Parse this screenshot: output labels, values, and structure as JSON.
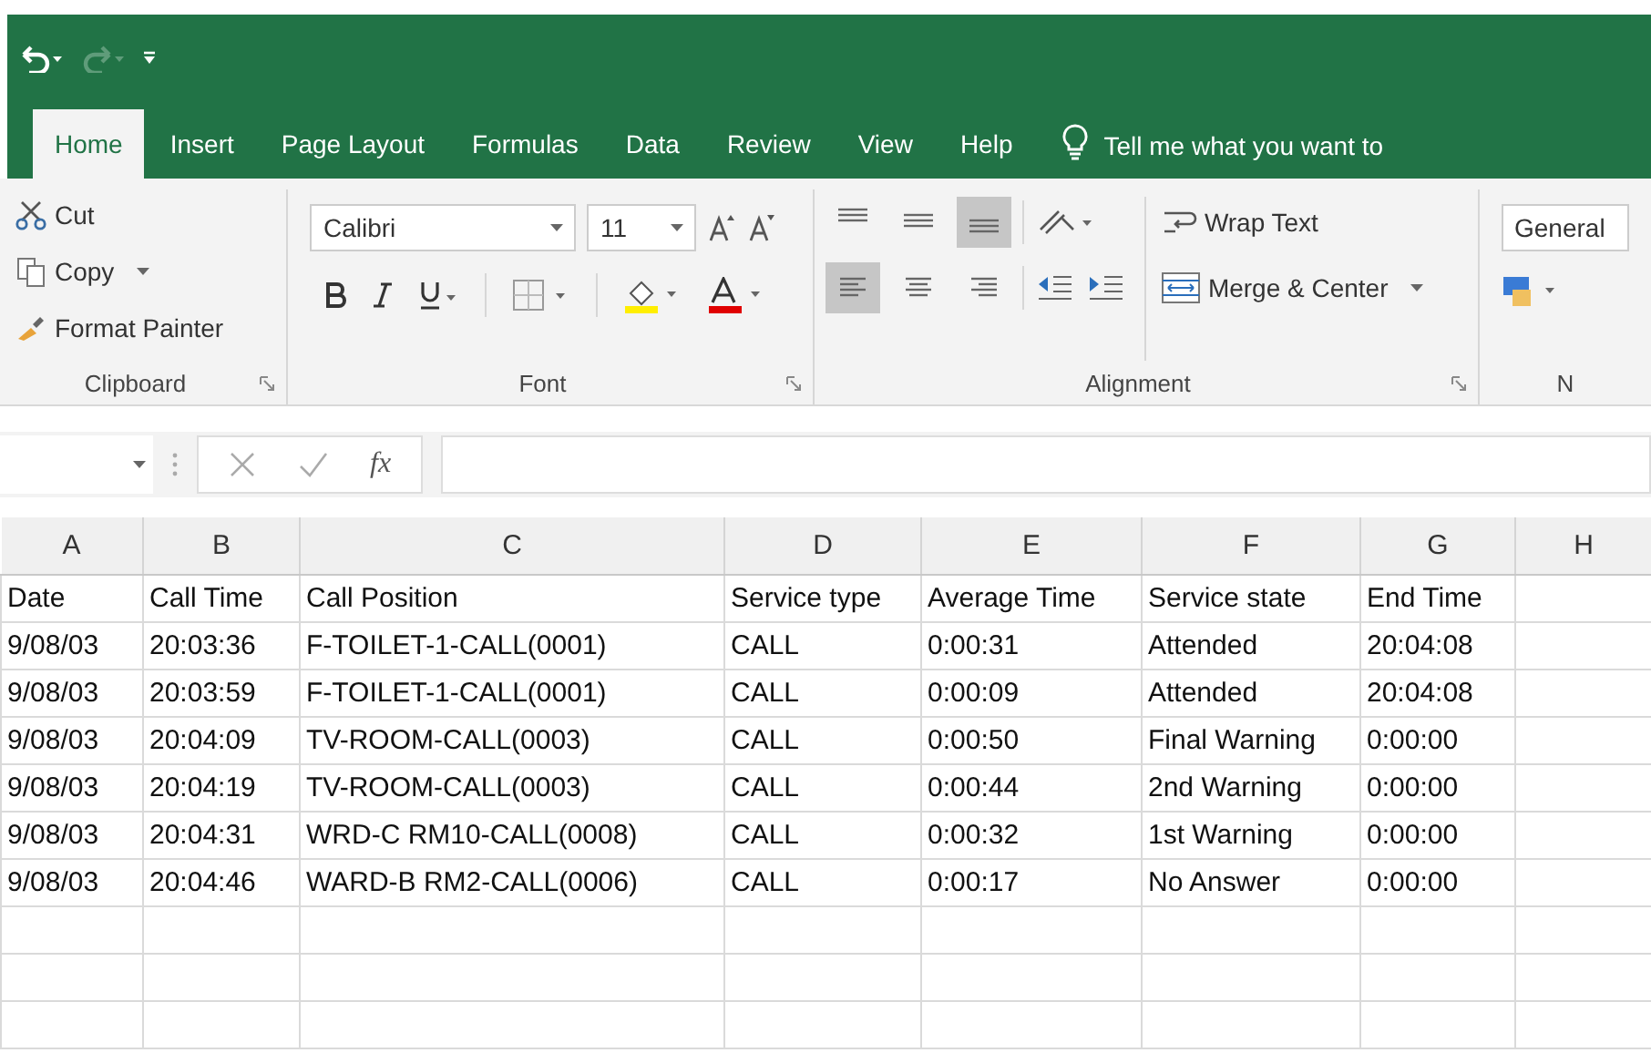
{
  "quick_access": [
    {
      "kind": "undo",
      "disabled": false
    },
    {
      "kind": "redo",
      "disabled": true
    },
    {
      "kind": "customize",
      "disabled": false
    }
  ],
  "tabs": [
    {
      "label": "Home",
      "selected": true
    },
    {
      "label": "Insert",
      "selected": false
    },
    {
      "label": "Page Layout",
      "selected": false
    },
    {
      "label": "Formulas",
      "selected": false
    },
    {
      "label": "Data",
      "selected": false
    },
    {
      "label": "Review",
      "selected": false
    },
    {
      "label": "View",
      "selected": false
    },
    {
      "label": "Help",
      "selected": false
    }
  ],
  "tell_me": "Tell me what you want to",
  "ribbon": {
    "clipboard": {
      "cut": "Cut",
      "copy": "Copy",
      "format_painter": "Format Painter",
      "label": "Clipboard"
    },
    "font": {
      "font_name": "Calibri",
      "font_size": "11",
      "label": "Font"
    },
    "alignment": {
      "vertical": [
        {
          "kind": "top",
          "selected": false
        },
        {
          "kind": "middle",
          "selected": false
        },
        {
          "kind": "bottom",
          "selected": true
        }
      ],
      "horizontal": [
        {
          "kind": "left",
          "selected": true
        },
        {
          "kind": "center",
          "selected": false
        },
        {
          "kind": "right",
          "selected": false
        }
      ],
      "wrap_text": "Wrap Text",
      "merge_center": "Merge & Center",
      "label": "Alignment"
    },
    "number": {
      "format": "General",
      "label": "N"
    }
  },
  "formula_bar": {
    "function_label": "fx"
  },
  "columns": [
    "A",
    "B",
    "C",
    "D",
    "E",
    "F",
    "G",
    "H"
  ],
  "rows": [
    [
      "Date",
      "Call Time",
      "Call Position",
      "Service type",
      "Average Time",
      "Service state",
      "End Time",
      ""
    ],
    [
      "9/08/03",
      "20:03:36",
      "F-TOILET-1-CALL(0001)",
      "CALL",
      "0:00:31",
      "Attended",
      "20:04:08",
      ""
    ],
    [
      "9/08/03",
      "20:03:59",
      "F-TOILET-1-CALL(0001)",
      "CALL",
      "0:00:09",
      "Attended",
      "20:04:08",
      ""
    ],
    [
      "9/08/03",
      "20:04:09",
      "TV-ROOM-CALL(0003)",
      "CALL",
      "0:00:50",
      "Final Warning",
      "0:00:00",
      ""
    ],
    [
      "9/08/03",
      "20:04:19",
      "TV-ROOM-CALL(0003)",
      "CALL",
      "0:00:44",
      "2nd Warning",
      "0:00:00",
      ""
    ],
    [
      "9/08/03",
      "20:04:31",
      "WRD-C RM10-CALL(0008)",
      "CALL",
      "0:00:32",
      "1st Warning",
      "0:00:00",
      ""
    ],
    [
      "9/08/03",
      "20:04:46",
      "WARD-B RM2-CALL(0006)",
      "CALL",
      "0:00:17",
      "No Answer",
      "0:00:00",
      ""
    ],
    [
      "",
      "",
      "",
      "",
      "",
      "",
      "",
      ""
    ],
    [
      "",
      "",
      "",
      "",
      "",
      "",
      "",
      ""
    ],
    [
      "",
      "",
      "",
      "",
      "",
      "",
      "",
      ""
    ]
  ]
}
